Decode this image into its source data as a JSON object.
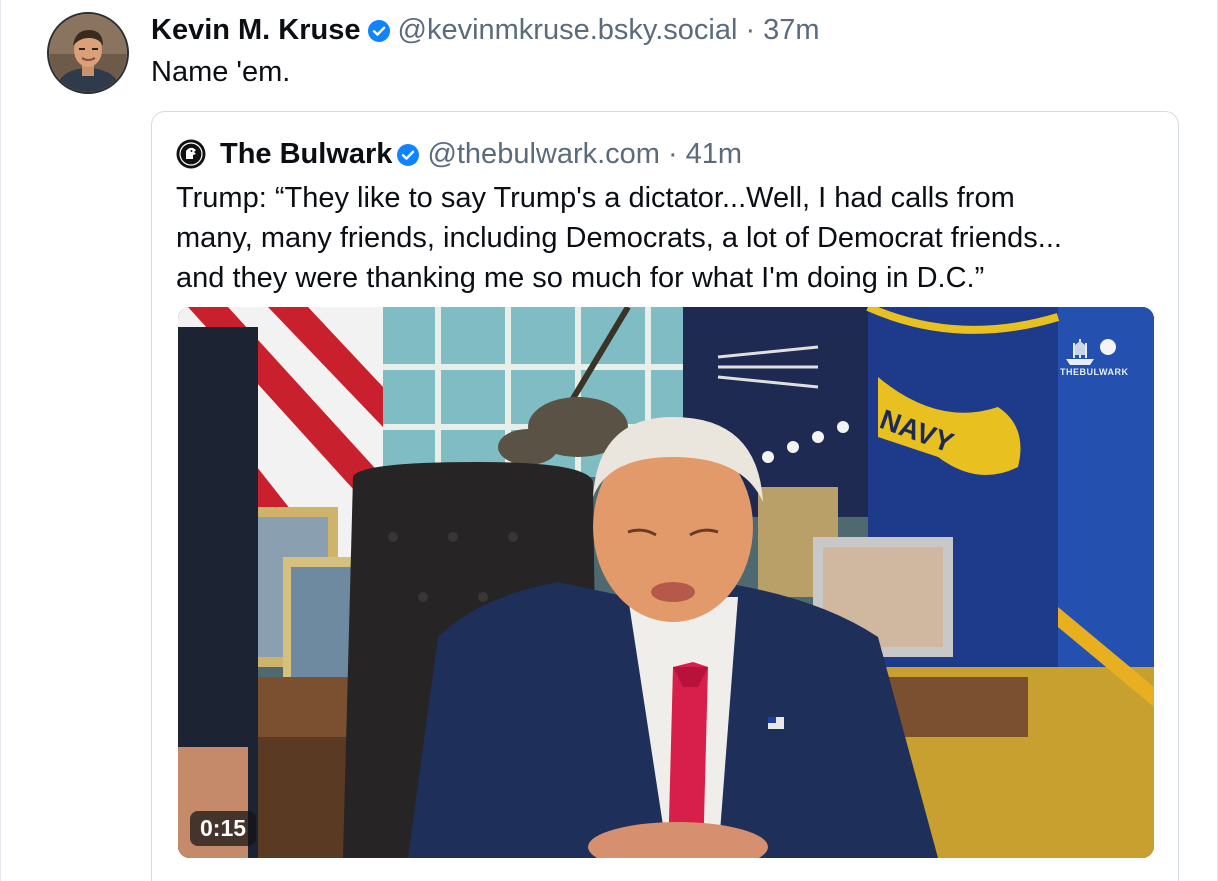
{
  "post": {
    "author": {
      "display_name": "Kevin M. Kruse",
      "handle": "@kevinmkruse.bsky.social",
      "verified": true,
      "avatar_icon": "author-avatar"
    },
    "separator": "·",
    "time": "37m",
    "text": "Name 'em."
  },
  "quote": {
    "author": {
      "display_name": "The Bulwark",
      "handle": "@thebulwark.com",
      "verified": true,
      "avatar_icon": "bulwark-logo-icon"
    },
    "separator": "·",
    "time": "41m",
    "text_lines": [
      "Trump: “They like to say Trump's a dictator...Well, I had calls from",
      "many, many friends, including Democrats, a lot of Democrat friends...",
      "and they were thanking me so much for what I'm doing in D.C.”"
    ],
    "video": {
      "duration": "0:15",
      "watermark": "THEBULWARK"
    }
  },
  "colors": {
    "text_primary": "#0b0f14",
    "text_secondary": "#5b6b7c",
    "verified_blue": "#1083fe",
    "card_border": "#d4dbe2"
  }
}
